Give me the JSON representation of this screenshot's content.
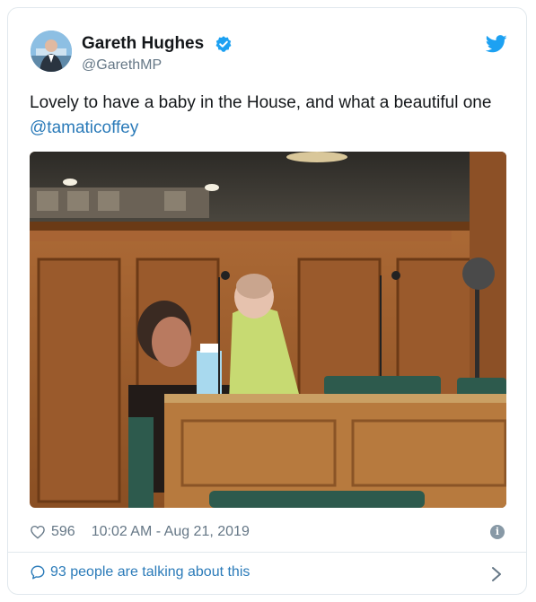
{
  "tweet": {
    "author_name": "Gareth Hughes",
    "handle": "@GarethMP",
    "text_plain": "Lovely to have a baby in the House, and what a beautiful one ",
    "mention": "@tamaticoffey",
    "likes": "596",
    "timestamp": "10:02 AM - Aug 21, 2019",
    "talking": "93 people are talking about this"
  },
  "colors": {
    "brand_blue": "#1da1f2",
    "link_blue": "#2b7bb9",
    "muted_gray": "#657786",
    "border": "#e1e8ed"
  },
  "icons": {
    "verified": "verified-badge-icon",
    "platform": "twitter-bird-icon",
    "like": "heart-outline-icon",
    "info": "info-icon",
    "conversation": "speech-bubble-icon",
    "open": "chevron-right-icon"
  }
}
